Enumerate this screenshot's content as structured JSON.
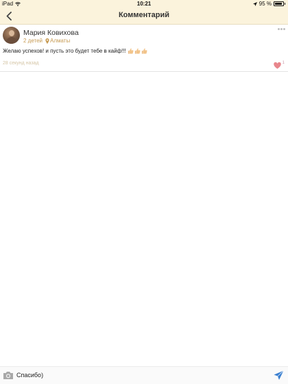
{
  "status_bar": {
    "device": "iPad",
    "time": "10:21",
    "battery": "95 %",
    "icons": [
      "wifi-icon",
      "location-arrow-icon",
      "battery-icon"
    ]
  },
  "nav": {
    "title": "Комментарий",
    "back_icon": "chevron-left-icon"
  },
  "comment": {
    "author": "Мария Ковихова",
    "children": "2 детей",
    "location": "Алматы",
    "text": "Желаю успехов! и пусть это будет тебе в кайф!!!",
    "emoji": [
      "thumbs-up",
      "thumbs-up",
      "thumbs-up"
    ],
    "time_ago": "28 секунд назад",
    "likes": "1",
    "colors": {
      "accent": "#c69a52",
      "like": "#e8868c"
    }
  },
  "composer": {
    "value": "Спасибо)",
    "camera_icon": "camera-icon",
    "send_icon": "send-icon"
  },
  "colors": {
    "header_bg": "#fbf3dc",
    "send": "#3a7fd0"
  }
}
